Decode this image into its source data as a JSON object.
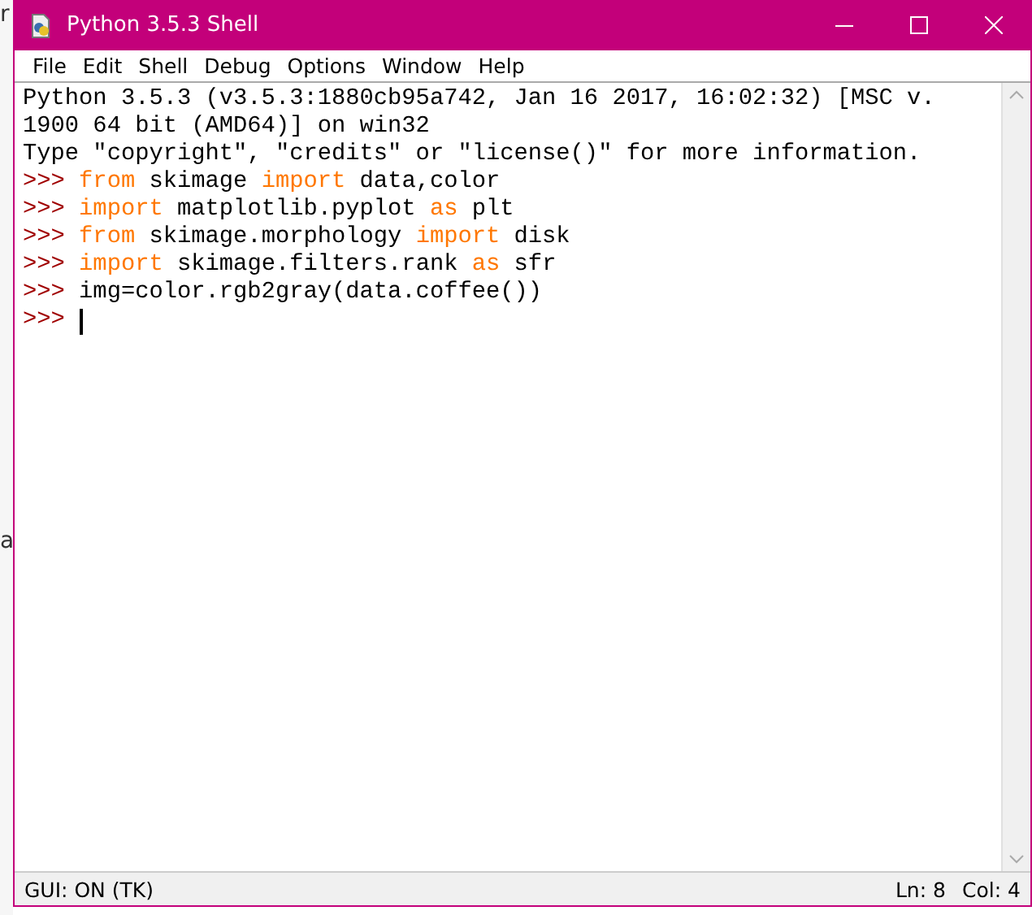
{
  "background_fragments": [
    "r",
    "a"
  ],
  "window": {
    "title": "Python 3.5.3 Shell"
  },
  "menu": [
    "File",
    "Edit",
    "Shell",
    "Debug",
    "Options",
    "Window",
    "Help"
  ],
  "shell_lines": [
    [
      {
        "kind": "output",
        "text": "Python 3.5.3 (v3.5.3:1880cb95a742, Jan 16 2017, 16:02:32) [MSC v."
      }
    ],
    [
      {
        "kind": "output",
        "text": "1900 64 bit (AMD64)] on win32"
      }
    ],
    [
      {
        "kind": "output",
        "text": "Type \"copyright\", \"credits\" or \"license()\" for more information."
      }
    ],
    [
      {
        "kind": "prompt",
        "text": ">>> "
      },
      {
        "kind": "keyword",
        "text": "from"
      },
      {
        "kind": "code",
        "text": " skimage "
      },
      {
        "kind": "keyword",
        "text": "import"
      },
      {
        "kind": "code",
        "text": " data,color"
      }
    ],
    [
      {
        "kind": "prompt",
        "text": ">>> "
      },
      {
        "kind": "keyword",
        "text": "import"
      },
      {
        "kind": "code",
        "text": " matplotlib.pyplot "
      },
      {
        "kind": "keyword",
        "text": "as"
      },
      {
        "kind": "code",
        "text": " plt"
      }
    ],
    [
      {
        "kind": "prompt",
        "text": ">>> "
      },
      {
        "kind": "keyword",
        "text": "from"
      },
      {
        "kind": "code",
        "text": " skimage.morphology "
      },
      {
        "kind": "keyword",
        "text": "import"
      },
      {
        "kind": "code",
        "text": " disk"
      }
    ],
    [
      {
        "kind": "prompt",
        "text": ">>> "
      },
      {
        "kind": "keyword",
        "text": "import"
      },
      {
        "kind": "code",
        "text": " skimage.filters.rank "
      },
      {
        "kind": "keyword",
        "text": "as"
      },
      {
        "kind": "code",
        "text": " sfr"
      }
    ],
    [
      {
        "kind": "prompt",
        "text": ">>> "
      },
      {
        "kind": "code",
        "text": "img=color.rgb2gray(data.coffee())"
      }
    ],
    [
      {
        "kind": "prompt",
        "text": ">>> "
      },
      {
        "kind": "cursor"
      }
    ]
  ],
  "status_bar": {
    "left": "GUI: ON (TK)",
    "line": "Ln: 8",
    "column": "Col: 4"
  }
}
